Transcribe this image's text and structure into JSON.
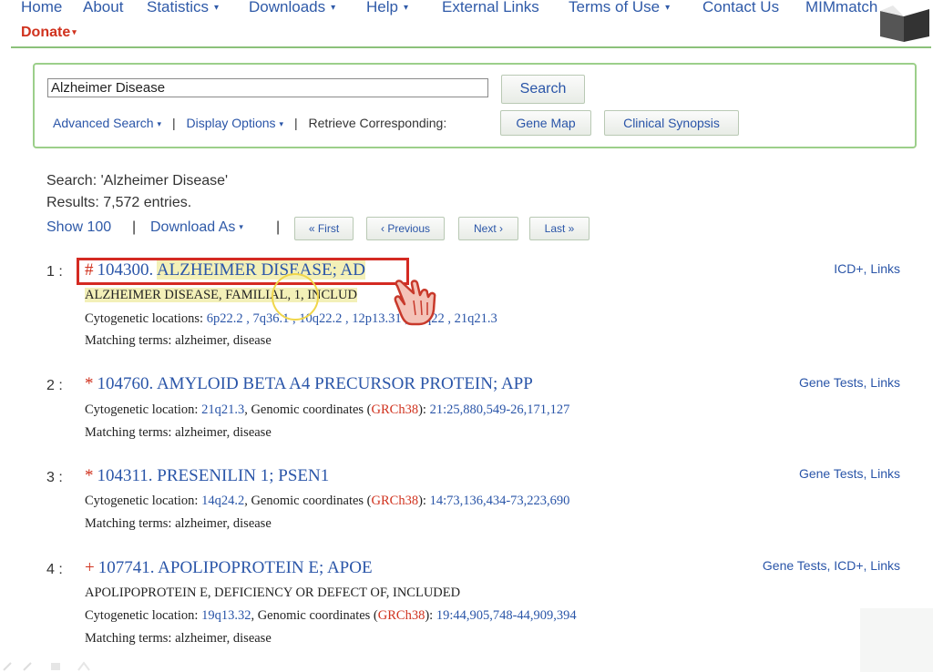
{
  "nav": {
    "items": [
      {
        "label": "Home",
        "dropdown": false
      },
      {
        "label": "About",
        "dropdown": false
      },
      {
        "label": "Statistics",
        "dropdown": true
      },
      {
        "label": "Downloads",
        "dropdown": true
      },
      {
        "label": "Help",
        "dropdown": true
      },
      {
        "label": "External Links",
        "dropdown": false
      },
      {
        "label": "Terms of Use",
        "dropdown": true
      },
      {
        "label": "Contact Us",
        "dropdown": false
      },
      {
        "label": "MIMmatch",
        "dropdown": false
      }
    ],
    "donate_label": "Donate",
    "caret": "▾"
  },
  "search": {
    "query": "Alzheimer Disease",
    "button_label": "Search",
    "advanced_label": "Advanced Search",
    "display_options_label": "Display Options",
    "retrieve_label": "Retrieve Corresponding:",
    "gene_map_label": "Gene Map",
    "clinical_synopsis_label": "Clinical Synopsis",
    "separator": "|"
  },
  "results_meta": {
    "search_text": "Search: 'Alzheimer Disease'",
    "results_text": "Results: 7,572 entries.",
    "show_label": "Show 100",
    "download_label": "Download As",
    "separator": "|",
    "pager": {
      "first": "« First",
      "previous": "‹ Previous",
      "next": "Next ›",
      "last": "Last »"
    }
  },
  "results": [
    {
      "number": "1 :",
      "symbol": "#",
      "mim": "104300.",
      "name": "ALZHEIMER DISEASE; AD",
      "alt_names": "ALZHEIMER DISEASE, FAMILIAL, 1, INCLUD",
      "cyto_label": "Cytogenetic locations:",
      "cyto_locations": "6p22.2 , 7q36.1 , 10q22.2 , 12p13.31 , 17q22 , 21q21.3",
      "matching_terms": "Matching terms: alzheimer, disease",
      "side_links": "ICD+, Links"
    },
    {
      "number": "2 :",
      "symbol": "*",
      "mim": "104760.",
      "name": "AMYLOID BETA A4 PRECURSOR PROTEIN; APP",
      "cyto_label": "Cytogenetic location:",
      "cyto_locations": "21q21.3",
      "genomic_label": ", Genomic coordinates (",
      "assembly": "GRCh38",
      "genomic_close": "):",
      "coordinates": "21:25,880,549-26,171,127",
      "matching_terms": "Matching terms: alzheimer, disease",
      "side_links": "Gene Tests, Links"
    },
    {
      "number": "3 :",
      "symbol": "*",
      "mim": "104311.",
      "name": "PRESENILIN 1; PSEN1",
      "cyto_label": "Cytogenetic location:",
      "cyto_locations": "14q24.2",
      "genomic_label": ", Genomic coordinates (",
      "assembly": "GRCh38",
      "genomic_close": "):",
      "coordinates": "14:73,136,434-73,223,690",
      "matching_terms": "Matching terms: alzheimer, disease",
      "side_links": "Gene Tests, Links"
    },
    {
      "number": "4 :",
      "symbol": "+",
      "mim": "107741.",
      "name": "APOLIPOPROTEIN E; APOE",
      "alt_names": "APOLIPOPROTEIN E, DEFICIENCY OR DEFECT OF, INCLUDED",
      "cyto_label": "Cytogenetic location:",
      "cyto_locations": "19q13.32",
      "genomic_label": ", Genomic coordinates (",
      "assembly": "GRCh38",
      "genomic_close": "):",
      "coordinates": "19:44,905,748-44,909,394",
      "matching_terms": "Matching terms: alzheimer, disease",
      "side_links": "Gene Tests, ICD+, Links"
    }
  ],
  "colors": {
    "link_blue": "#2a55a8",
    "omim_red": "#d0321e",
    "green_border": "#9ccf8a",
    "annotation_red": "#d42a22",
    "highlight_yellow": "#f3f0b8"
  },
  "icons": {
    "pointer": "hand-pointer-icon",
    "cursor_ring": "click-indicator",
    "corner": "book-icon"
  }
}
